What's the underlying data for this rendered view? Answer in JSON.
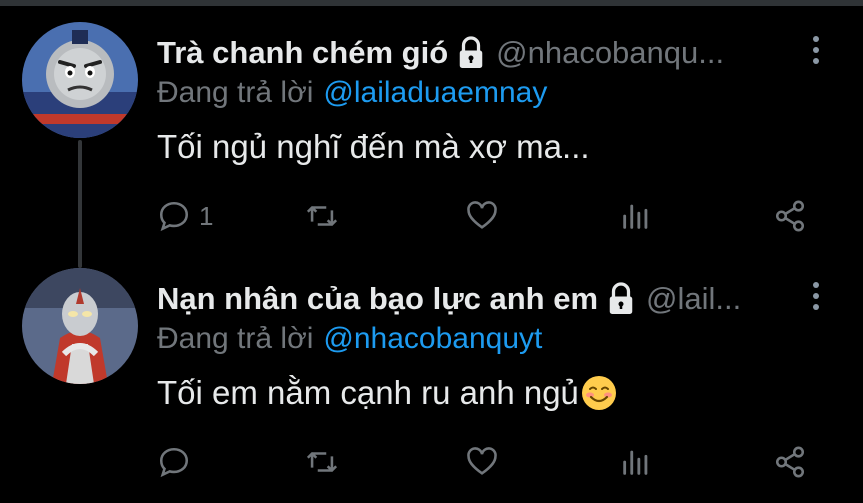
{
  "tweets": [
    {
      "display_name": "Trà chanh chém gió",
      "handle": "@nhacobanqu...",
      "replying_label": "Đang trả lời",
      "replying_to": "@lailaduaemnay",
      "text": "Tối ngủ nghĩ đến mà xợ ma...",
      "reply_count": "1",
      "avatar": "blue-cartoon-train-face-icon"
    },
    {
      "display_name": "Nạn nhân của bạo lực anh em",
      "handle": "@lail...",
      "replying_label": "Đang trả lời",
      "replying_to": "@nhacobanquyt",
      "text": "Tối em nằm cạnh ru anh ngủ",
      "emoji": "smiling-face-emoji",
      "reply_count": "",
      "avatar": "red-silver-hero-figure-icon"
    }
  ],
  "colors": {
    "background": "#000000",
    "text_primary": "#e7e9ea",
    "text_secondary": "#71767b",
    "mention": "#1d9bf0",
    "divider": "#2f3336"
  }
}
